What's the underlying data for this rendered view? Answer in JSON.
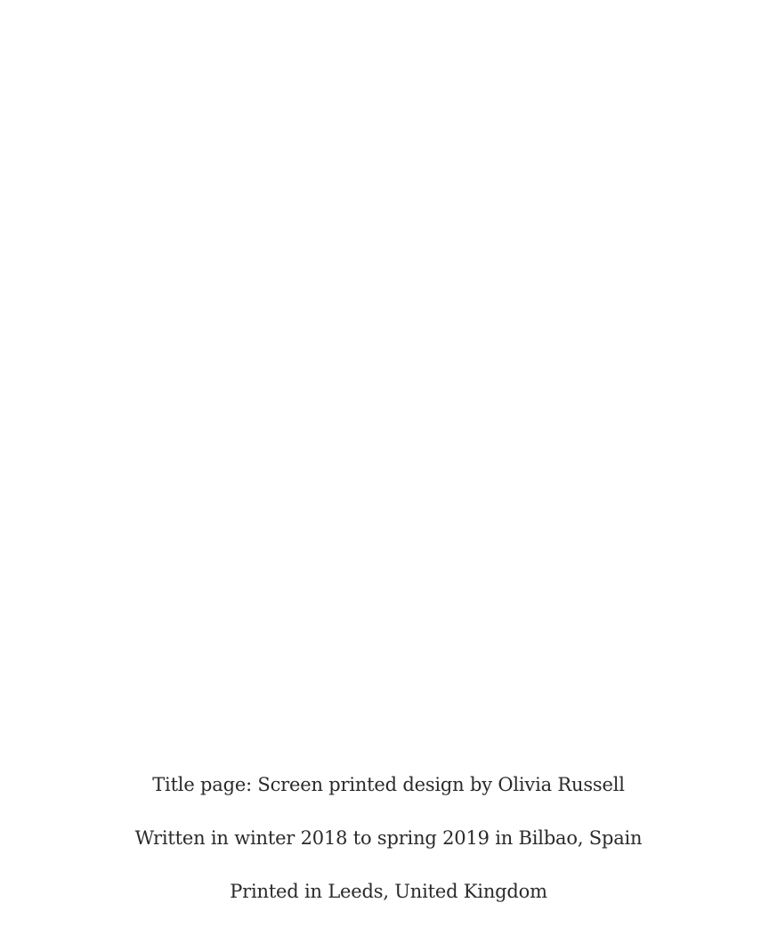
{
  "colophon": {
    "title_page_credit": "Title page: Screen printed design by Olivia Russell",
    "written_note": "Written in winter 2018 to spring 2019 in Bilbao, Spain",
    "printed_note": "Printed in Leeds, United Kingdom"
  }
}
